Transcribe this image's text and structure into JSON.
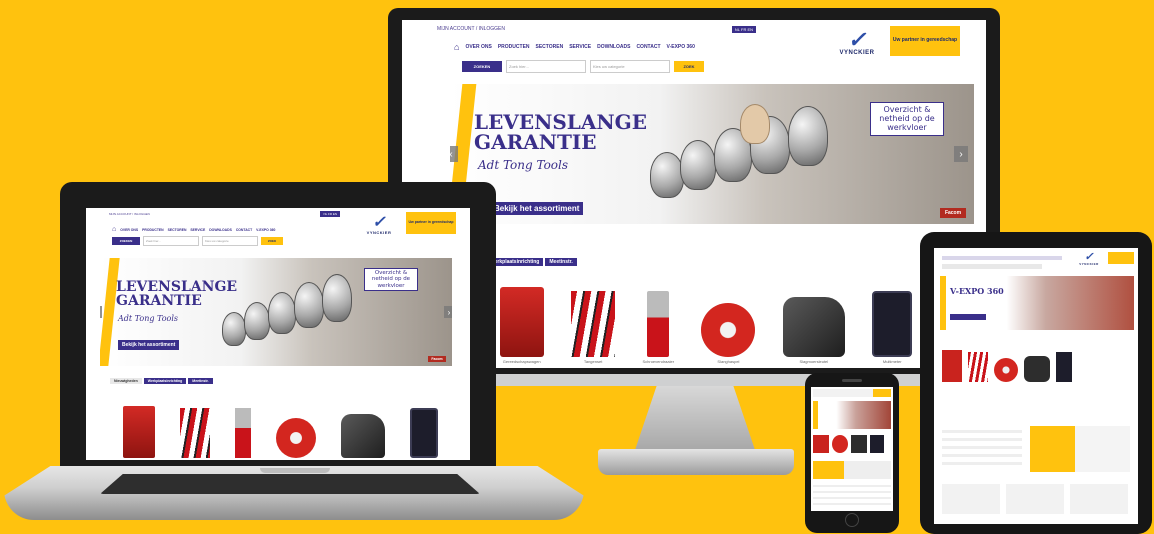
{
  "colors": {
    "background": "#FFC20E",
    "brand_purple": "#3a2f8a",
    "brand_blue": "#2e4fa8",
    "accent_yellow": "#FFC20E"
  },
  "site": {
    "account_link": "MIJN ACCOUNT / INLOGGEN",
    "language": "NL  FR  EN",
    "nav": [
      "OVER ONS",
      "PRODUCTEN",
      "SECTOREN",
      "SERVICE",
      "DOWNLOADS",
      "CONTACT",
      "V-EXPO 360"
    ],
    "logo_text": "VYNCKIER",
    "yellow_tag": "Uw partner in gereedschap",
    "search": {
      "label": "ZOEKEN",
      "placeholder": "Zoek hier...",
      "category_placeholder": "Kies uw categorie",
      "button": "ZOEK"
    },
    "banner": {
      "headline_1": "LEVENSLANGE",
      "headline_2": "GARANTIE",
      "script": "Adt Tong Tools",
      "cta": "Bekijk het assortiment",
      "overview": "Overzicht & netheid op de werkvloer",
      "brand_badge": "Facom"
    },
    "tabs": [
      "Nieuwigheden",
      "Werkplaatsinrichting",
      "Meetinstr."
    ],
    "products": [
      {
        "caption": "Gereedschapswagen"
      },
      {
        "caption": "Tangenset"
      },
      {
        "caption": "Schroevendraaier"
      },
      {
        "caption": "Slanghaspel"
      },
      {
        "caption": "Slagmoersleutel"
      },
      {
        "caption": "Multimeter"
      }
    ],
    "tablet_banner": "V-EXPO 360"
  }
}
